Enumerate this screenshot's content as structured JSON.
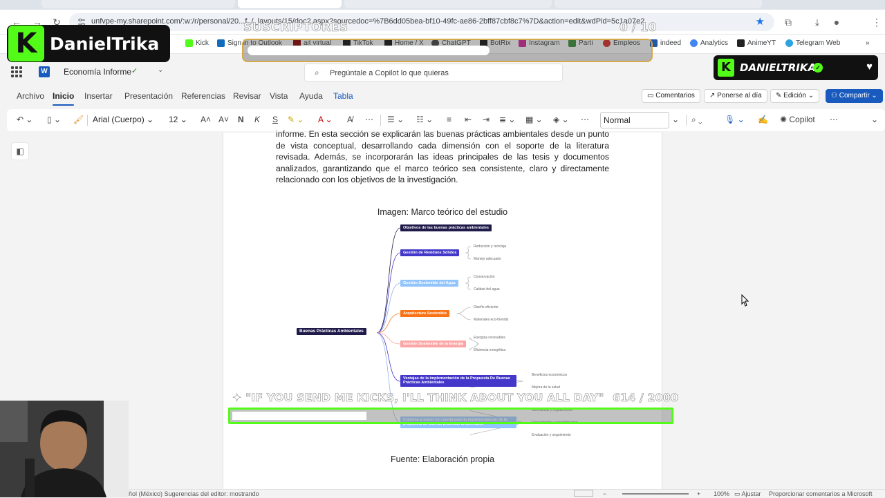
{
  "browser": {
    "url": "unfvpe-my.sharepoint.com/:w:/r/personal/20...f../_layouts/15/doc2.aspx?sourcedoc=%7B6dd05bea-bf10-49fc-ae86-2bff87cbf8c7%7D&action=edit&wdPid=5c1a07e2",
    "bookmarks": [
      {
        "label": "Kick",
        "color": "#53fc18"
      },
      {
        "label": "Sign in to Outlook",
        "color": "#0f6cbd"
      },
      {
        "label": "ait virtual",
        "color": "#8b0000"
      },
      {
        "label": "TikTok",
        "color": "#111111"
      },
      {
        "label": "Home / X",
        "color": "#111111"
      },
      {
        "label": "ChatGPT",
        "color": "#444444"
      },
      {
        "label": "BotRix",
        "color": "#111111"
      },
      {
        "label": "Instagram",
        "color": "#d6249f"
      },
      {
        "label": "Parti",
        "color": "#3a8f3a"
      },
      {
        "label": "Empleos",
        "color": "#d93025"
      },
      {
        "label": "indeed",
        "color": "#2557a7"
      },
      {
        "label": "Analytics",
        "color": "#4285f4"
      },
      {
        "label": "AnimeYT",
        "color": "#222222"
      },
      {
        "label": "Telegram Web",
        "color": "#2aa3e0"
      }
    ]
  },
  "word": {
    "doc_title": "Economía Informe",
    "search_placeholder": "Pregúntale a Copilot lo que quieras",
    "tabs": [
      "Archivo",
      "Inicio",
      "Insertar",
      "Presentación",
      "Referencias",
      "Revisar",
      "Vista",
      "Ayuda",
      "Tabla"
    ],
    "active_tab": "Inicio",
    "right_buttons": {
      "comments": "Comentarios",
      "catch_up": "Ponerse al día",
      "editing": "Edición",
      "share": "Compartir"
    },
    "toolbar": {
      "font": "Arial (Cuerpo)",
      "size": "12",
      "style": "Normal",
      "copilot": "Copilot"
    }
  },
  "document": {
    "paragraph": "informe. En esta sección se explicarán las buenas prácticas ambientales desde un punto de vista conceptual, desarrollando cada dimensión con el soporte de la literatura revisada. Además, se incorporarán las ideas principales de las tesis y documentos analizados, garantizando que el marco teórico sea consistente, claro y directamente relacionado con los objetivos de la investigación.",
    "figure_caption": "Imagen: Marco teórico del estudio",
    "source": "Fuente: Elaboración propia",
    "mindmap": {
      "root": "Buenas Prácticas Ambientales",
      "branches": [
        {
          "label": "Objetivos de las buenas prácticas ambientales",
          "color": "#1e1b4b",
          "leaves": []
        },
        {
          "label": "Gestión de Residuos Sólidos",
          "color": "#4338ca",
          "leaves": [
            "Reducción y reciclaje",
            "Manejo adecuado"
          ]
        },
        {
          "label": "Gestión Sostenible del Agua",
          "color": "#93c5fd",
          "leaves": [
            "Conservación",
            "Calidad del agua"
          ]
        },
        {
          "label": "Arquitectura Sostenible",
          "color": "#f97316",
          "leaves": [
            "Diseño eficiente",
            "Materiales eco-friendly"
          ]
        },
        {
          "label": "Gestión Sostenible de la Energía",
          "color": "#fca5a5",
          "leaves": [
            "Energías renovables",
            "Eficiencia energética"
          ]
        },
        {
          "label": "Ventajas de la implementación de la Propuesta De Buenas Prácticas Ambientales",
          "color": "#4338ca",
          "leaves": [
            "Beneficios económicos",
            "Mejora de la salud"
          ]
        },
        {
          "label": "Criterios a tomar en cuenta para la implementación de la propuesta de buenas prácticas ambientales",
          "color": "#93c5fd",
          "leaves": [
            "Normativas y regulaciones",
            "Capacitación y sensibilización",
            "Evaluación y seguimiento"
          ]
        }
      ]
    }
  },
  "status": {
    "left": "ñol (México)   Sugerencias del editor: mostrando",
    "zoom": "100%",
    "fit": "Ajustar",
    "feedback": "Proporcionar comentarios a Microsoft"
  },
  "overlay": {
    "brand": "DanielTrika",
    "badge_name": "DANIELTRIKA",
    "subs_title": "SUSCRIPTORES",
    "subs_count": "0 / 10",
    "subs_progress": 0,
    "kick_quote": "\"IF YOU SEND ME KICKS, I'LL THINK ABOUT YOU ALL DAY\"",
    "kick_count": "614  / 2000",
    "kick_progress": 0.307
  }
}
